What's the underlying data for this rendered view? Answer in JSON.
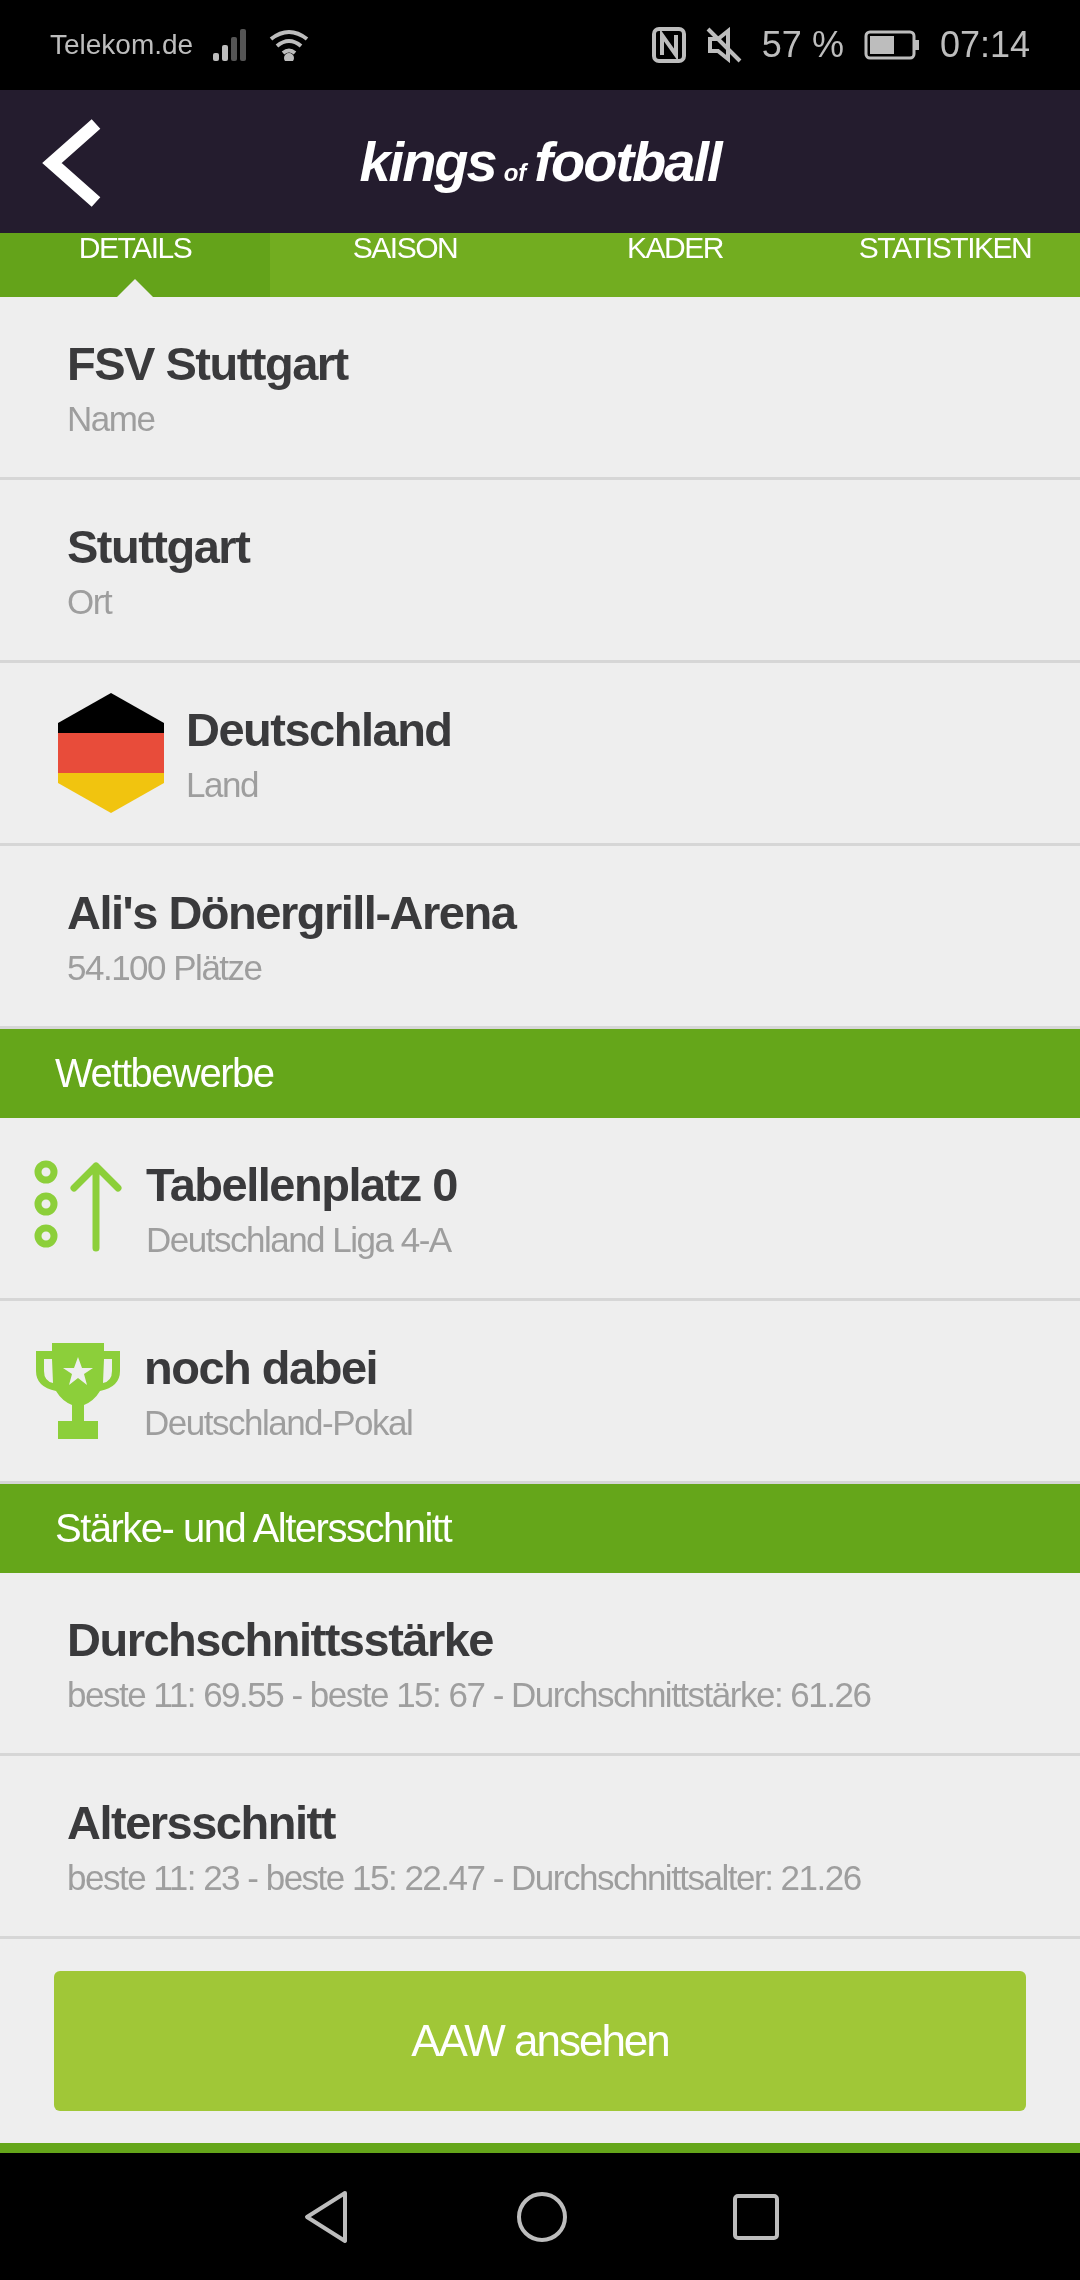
{
  "status_bar": {
    "carrier": "Telekom.de",
    "battery": "57 %",
    "time": "07:14"
  },
  "header": {
    "logo_main": "kings",
    "logo_small": "of",
    "logo_end": "football"
  },
  "tabs": [
    {
      "label": "DETAILS",
      "selected": true
    },
    {
      "label": "SAISON",
      "selected": false
    },
    {
      "label": "KADER",
      "selected": false
    },
    {
      "label": "STATISTIKEN",
      "selected": false
    }
  ],
  "details": [
    {
      "kind": "text",
      "title": "FSV Stuttgart",
      "subtitle": "Name"
    },
    {
      "kind": "text",
      "title": "Stuttgart",
      "subtitle": "Ort"
    },
    {
      "kind": "flag",
      "title": "Deutschland",
      "subtitle": "Land"
    },
    {
      "kind": "text",
      "title": "Ali's Dönergrill-Arena",
      "subtitle": "54.100 Plätze"
    }
  ],
  "sections": [
    {
      "title": "Wettbewerbe",
      "rows": [
        {
          "kind": "rank",
          "title": "Tabellenplatz 0",
          "subtitle": "Deutschland Liga 4-A"
        },
        {
          "kind": "trophy",
          "title": "noch dabei",
          "subtitle": "Deutschland-Pokal"
        }
      ]
    },
    {
      "title": "Stärke- und Altersschnitt",
      "rows": [
        {
          "kind": "text",
          "title": "Durchschnittsstärke",
          "subtitle": "beste 11: 69.55 - beste 15: 67 - Durchschnittstärke: 61.26"
        },
        {
          "kind": "text",
          "title": "Altersschnitt",
          "subtitle": "beste 11: 23 - beste 15: 22.47 - Durchschnittsalter: 21.26"
        }
      ]
    }
  ],
  "action_button": {
    "label": "AAW ansehen"
  }
}
